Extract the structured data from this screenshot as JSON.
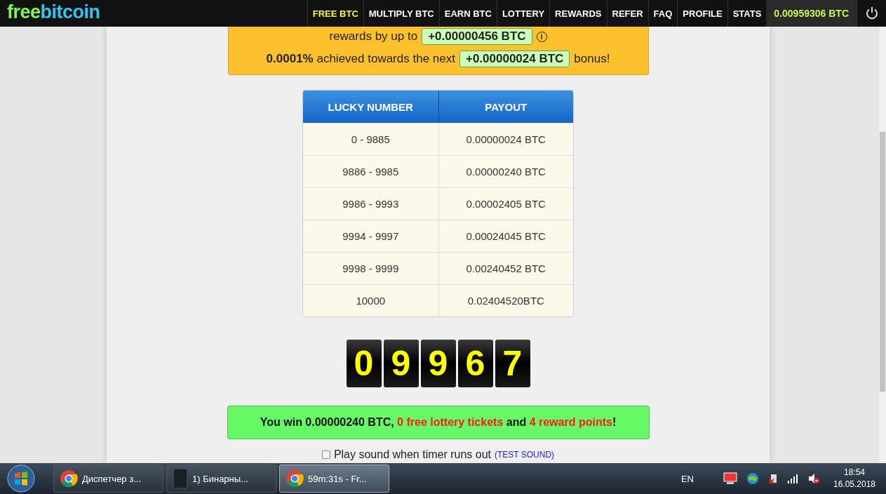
{
  "header": {
    "logo": {
      "part1": "free",
      "part2": "bitcoin"
    },
    "nav": [
      {
        "label": "FREE BTC",
        "selected": true
      },
      {
        "label": "MULTIPLY BTC",
        "selected": false
      },
      {
        "label": "EARN BTC",
        "selected": false
      },
      {
        "label": "LOTTERY",
        "selected": false
      },
      {
        "label": "REWARDS",
        "selected": false
      },
      {
        "label": "REFER",
        "selected": false
      },
      {
        "label": "FAQ",
        "selected": false
      },
      {
        "label": "PROFILE",
        "selected": false
      },
      {
        "label": "STATS",
        "selected": false
      }
    ],
    "balance": "0.00959306 BTC"
  },
  "bonus_box": {
    "line1_text": "rewards by up to",
    "line1_badge": "+0.00000456 BTC",
    "line1_info": "i",
    "line2_text": "**0.0001%** achieved towards the next",
    "line2_badge": "+0.00000024 BTC",
    "line2_suffix": "bonus!"
  },
  "table": {
    "columns": [
      "LUCKY NUMBER",
      "PAYOUT"
    ],
    "rows": [
      [
        "0 - 9885",
        "0.00000024 BTC"
      ],
      [
        "9886 - 9985",
        "0.00000240 BTC"
      ],
      [
        "9986 - 9993",
        "0.00002405 BTC"
      ],
      [
        "9994 - 9997",
        "0.00024045 BTC"
      ],
      [
        "9998 - 9999",
        "0.00240452 BTC"
      ],
      [
        "10000",
        "0.02404520BTC"
      ]
    ]
  },
  "digits": [
    "0",
    "9",
    "9",
    "6",
    "7"
  ],
  "win_message": [
    {
      "text": "You win 0.00000240 BTC, ",
      "kind": "normal"
    },
    {
      "text": "0 free lottery tickets",
      "kind": "highlight"
    },
    {
      "text": " and ",
      "kind": "normal"
    },
    {
      "text": "4 reward points",
      "kind": "highlight"
    },
    {
      "text": "!",
      "kind": "normal"
    }
  ],
  "sound": {
    "label": "Play sound when timer runs out",
    "checked": false,
    "link": "(TEST SOUND)"
  },
  "taskbar": {
    "tasks": [
      {
        "label": "Диспетчер з...",
        "kind": "chrome",
        "selected": false
      },
      {
        "label": "1) Бинарны...",
        "kind": "window",
        "selected": false
      },
      {
        "label": "59m:31s - Fr...",
        "kind": "chrome",
        "selected": true
      }
    ],
    "language": "EN",
    "time": "18:54",
    "date": "16.05.2018"
  }
}
